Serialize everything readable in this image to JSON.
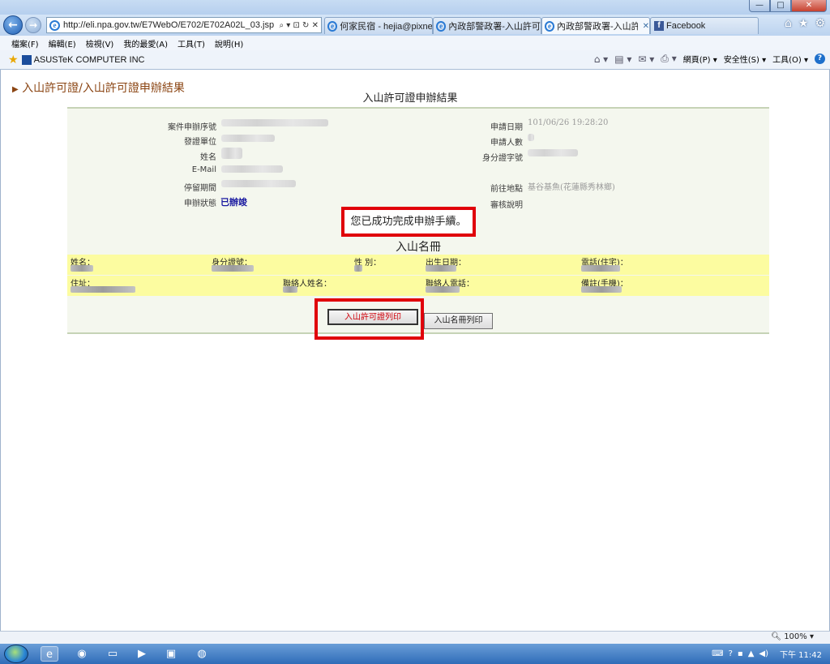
{
  "browser": {
    "address_url": "http://eli.npa.gov.tw/E7WebO/E702/E702A02L_03.jsp",
    "address_icons": "⌕ ▾ ⊡ ↻ ✕",
    "tabs": [
      {
        "label": "何家民宿 - hejia@pixne...",
        "active": false
      },
      {
        "label": "內政部警政署-入山許可證",
        "active": false
      },
      {
        "label": "內政部警政署-入山許...",
        "active": true
      },
      {
        "label": "Facebook",
        "active": false
      }
    ],
    "tab_close": "✕",
    "window_controls": {
      "minimize": "—",
      "maximize": "□",
      "close": "✕"
    },
    "menu": [
      "檔案(F)",
      "編輯(E)",
      "檢視(V)",
      "我的最愛(A)",
      "工具(T)",
      "說明(H)"
    ],
    "favorite_link": "ASUSTeK COMPUTER INC",
    "command_bar": [
      "網頁(P) ▾",
      "安全性(S) ▾",
      "工具(O) ▾"
    ],
    "zoom": "100%"
  },
  "page": {
    "breadcrumb": "入山許可證/入山許可證申辦結果",
    "title": "入山許可證申辦結果",
    "fields_left": [
      {
        "label": "案件申辦序號"
      },
      {
        "label": "發證單位"
      },
      {
        "label": "姓名"
      },
      {
        "label": "E-Mail"
      },
      {
        "label": "停留期間"
      },
      {
        "label": "申辦狀態"
      }
    ],
    "status_value": "已辦竣",
    "fields_right": [
      {
        "label": "申請日期",
        "value": "101/06/26 19:28:20"
      },
      {
        "label": "申請人數",
        "value": ""
      },
      {
        "label": "身分證字號",
        "value": ""
      },
      {
        "label": "前往地點",
        "value": "基谷基魚(花蓮縣秀林鄉)"
      },
      {
        "label": "審核說明",
        "value": ""
      }
    ],
    "success_message": "您已成功完成申辦手續。",
    "roster_title": "入山名冊",
    "roster_row1": [
      "姓名：",
      "身分證號：",
      "性 別：",
      "出生日期：",
      "電話(住宅)："
    ],
    "roster_row2": [
      "住址：",
      "聯絡人姓名：",
      "聯絡人電話：",
      "備註(手機)："
    ],
    "buttons": {
      "permit_print": "入山許可證列印",
      "roster_print": "入山名冊列印"
    }
  },
  "taskbar": {
    "clock": "下午 11:42"
  }
}
